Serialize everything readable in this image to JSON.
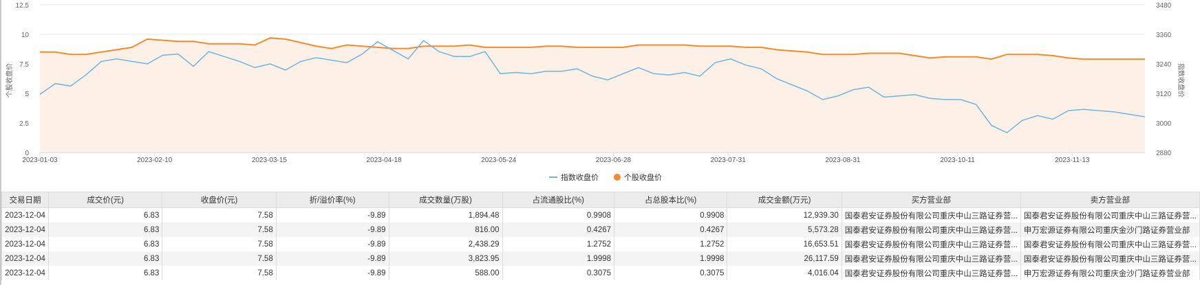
{
  "chart_data": {
    "type": "line",
    "left_axis": {
      "label": "个股收盘价",
      "ticks": [
        "0",
        "2.5",
        "5",
        "7.5",
        "10",
        "12.5"
      ],
      "range": [
        0,
        12.5
      ]
    },
    "right_axis": {
      "label": "指数收盘价",
      "ticks": [
        "2880",
        "3000",
        "3120",
        "3240",
        "3360",
        "3480"
      ],
      "range": [
        2880,
        3480
      ]
    },
    "x_ticks": [
      "2023-01-03",
      "2023-02-10",
      "2023-03-15",
      "2023-04-18",
      "2023-05-24",
      "2023-06-28",
      "2023-07-31",
      "2023-08-31",
      "2023-10-11",
      "2023-11-13"
    ],
    "grid": true,
    "legend": {
      "position": "bottom-center"
    },
    "series": [
      {
        "name": "指数收盘价",
        "axis": "right",
        "color": "#6cb4e6",
        "values": [
          3116,
          3160,
          3150,
          3195,
          3250,
          3260,
          3250,
          3240,
          3275,
          3280,
          3230,
          3290,
          3270,
          3250,
          3225,
          3240,
          3215,
          3250,
          3265,
          3255,
          3245,
          3280,
          3330,
          3295,
          3260,
          3335,
          3290,
          3270,
          3270,
          3290,
          3200,
          3205,
          3200,
          3210,
          3210,
          3220,
          3190,
          3175,
          3200,
          3225,
          3200,
          3195,
          3205,
          3190,
          3245,
          3260,
          3235,
          3220,
          3180,
          3155,
          3130,
          3095,
          3110,
          3135,
          3145,
          3105,
          3110,
          3115,
          3100,
          3095,
          3095,
          3075,
          2990,
          2960,
          3010,
          3030,
          3015,
          3050,
          3055,
          3050,
          3045,
          3035,
          3025
        ]
      },
      {
        "name": "个股收盘价",
        "axis": "left",
        "color": "#f58a2a",
        "area": true,
        "values": [
          8.5,
          8.5,
          8.3,
          8.3,
          8.5,
          8.7,
          8.9,
          9.6,
          9.5,
          9.4,
          9.4,
          9.2,
          9.2,
          9.2,
          9.1,
          9.7,
          9.6,
          9.3,
          9.0,
          8.8,
          9.1,
          9.0,
          8.9,
          8.8,
          8.8,
          9.0,
          9.0,
          9.0,
          9.1,
          8.9,
          8.9,
          8.9,
          8.9,
          9.0,
          9.0,
          8.9,
          8.9,
          8.9,
          8.9,
          9.1,
          9.1,
          9.1,
          9.1,
          9.0,
          9.0,
          9.0,
          8.9,
          8.9,
          8.7,
          8.6,
          8.5,
          8.3,
          8.3,
          8.3,
          8.4,
          8.4,
          8.4,
          8.2,
          8.0,
          8.1,
          8.1,
          8.1,
          7.9,
          8.3,
          8.3,
          8.3,
          8.2,
          8.0,
          7.9,
          7.9,
          7.9,
          7.9,
          7.9
        ]
      }
    ]
  },
  "legend": {
    "index": "指数收盘价",
    "stock": "个股收盘价"
  },
  "table": {
    "headers": [
      "交易日期",
      "成交价(元)",
      "收盘价(元)",
      "折/溢价率(%)",
      "成交数量(万股)",
      "占流通股比(%)",
      "占总股本比(%)",
      "成交金额(万元)",
      "买方营业部",
      "卖方营业部"
    ],
    "rows": [
      [
        "2023-12-04",
        "6.83",
        "7.58",
        "-9.89",
        "1,894.48",
        "0.9908",
        "0.9908",
        "12,939.30",
        "国泰君安证券股份有限公司重庆中山三路证券营...",
        "国泰君安证券股份有限公司重庆中山三路证券营..."
      ],
      [
        "2023-12-04",
        "6.83",
        "7.58",
        "-9.89",
        "816.00",
        "0.4267",
        "0.4267",
        "5,573.28",
        "国泰君安证券股份有限公司重庆中山三路证券营...",
        "申万宏源证券有限公司重庆金沙门路证券营业部"
      ],
      [
        "2023-12-04",
        "6.83",
        "7.58",
        "-9.89",
        "2,438.29",
        "1.2752",
        "1.2752",
        "16,653.51",
        "国泰君安证券股份有限公司重庆中山三路证券营...",
        "国泰君安证券股份有限公司重庆中山三路证券营..."
      ],
      [
        "2023-12-04",
        "6.83",
        "7.58",
        "-9.89",
        "3,823.95",
        "1.9998",
        "1.9998",
        "26,117.59",
        "国泰君安证券股份有限公司重庆中山三路证券营...",
        "国泰君安证券股份有限公司重庆中山三路证券营..."
      ],
      [
        "2023-12-04",
        "6.83",
        "7.58",
        "-9.89",
        "588.00",
        "0.3075",
        "0.3075",
        "4,016.04",
        "国泰君安证券股份有限公司重庆中山三路证券营...",
        "申万宏源证券有限公司重庆金沙门路证券营业部"
      ]
    ]
  }
}
